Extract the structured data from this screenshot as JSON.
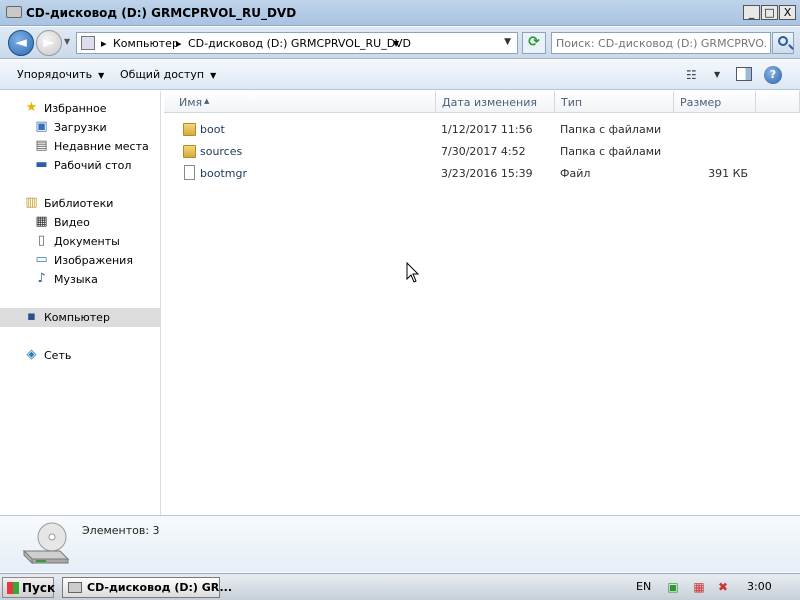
{
  "window": {
    "title": "CD-дисковод (D:) GRMCPRVOL_RU_DVD",
    "minimize": "_",
    "maximize": "□",
    "close": "X"
  },
  "address": {
    "back": "◄",
    "forward": "►",
    "crumbs": [
      "Компьютер",
      "CD-дисковод (D:) GRMCPRVOL_RU_DVD"
    ],
    "search_placeholder": "Поиск: CD-дисковод (D:) GRMCPRVO..."
  },
  "toolbar": {
    "organize": "Упорядочить",
    "share": "Общий доступ",
    "help": "?"
  },
  "navpane": {
    "favorites": {
      "label": "Избранное",
      "items": [
        "Загрузки",
        "Недавние места",
        "Рабочий стол"
      ]
    },
    "libraries": {
      "label": "Библиотеки",
      "items": [
        "Видео",
        "Документы",
        "Изображения",
        "Музыка"
      ]
    },
    "computer": "Компьютер",
    "network": "Сеть"
  },
  "columns": {
    "name": "Имя",
    "date": "Дата изменения",
    "type": "Тип",
    "size": "Размер"
  },
  "files": [
    {
      "name": "boot",
      "date": "1/12/2017 11:56",
      "type": "Папка с файлами",
      "size": "",
      "kind": "folder"
    },
    {
      "name": "sources",
      "date": "7/30/2017 4:52",
      "type": "Папка с файлами",
      "size": "",
      "kind": "folder"
    },
    {
      "name": "bootmgr",
      "date": "3/23/2016 15:39",
      "type": "Файл",
      "size": "391 КБ",
      "kind": "file"
    }
  ],
  "details": {
    "items_count": "Элементов: 3"
  },
  "taskbar": {
    "start": "Пуск",
    "task": "CD-дисковод (D:) GR...",
    "lang": "EN",
    "clock": "3:00"
  }
}
